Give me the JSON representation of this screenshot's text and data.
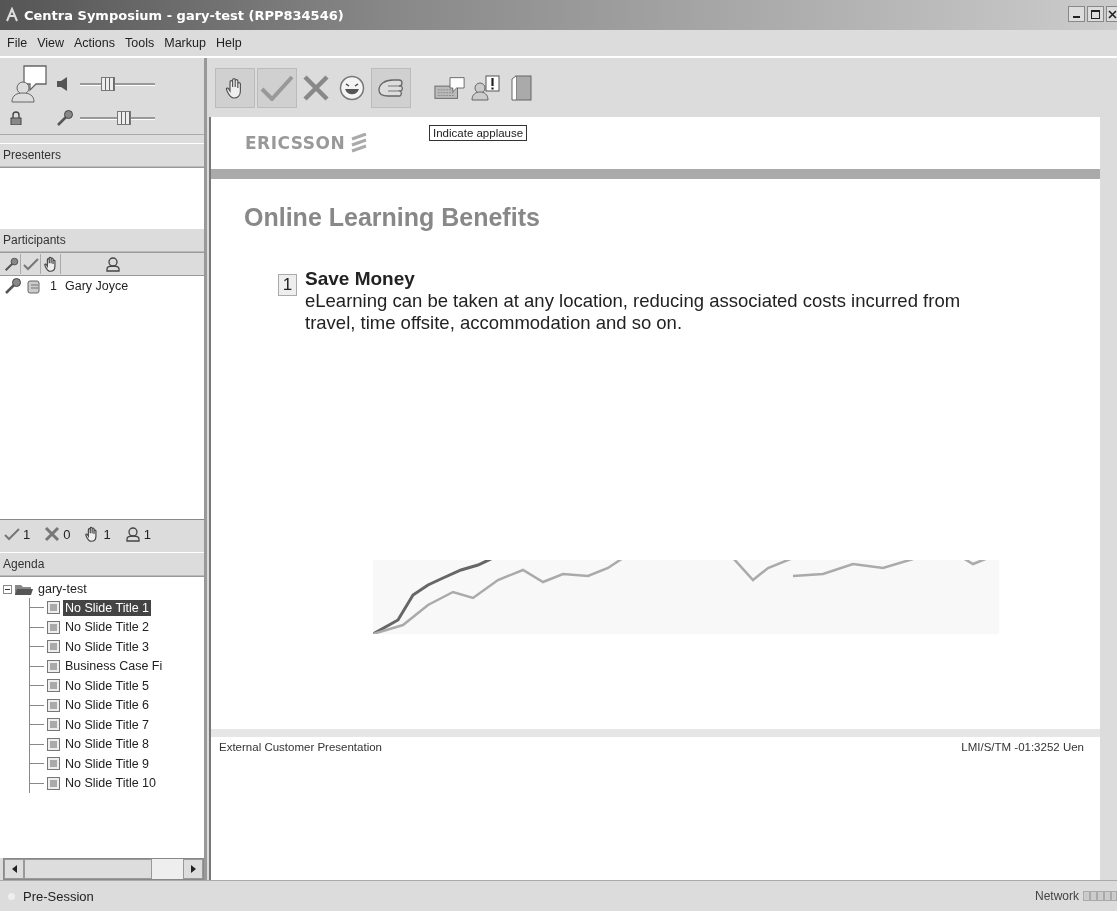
{
  "window": {
    "title": "Centra Symposium - gary-test (RPP834546)"
  },
  "menu": [
    "File",
    "View",
    "Actions",
    "Tools",
    "Markup",
    "Help"
  ],
  "audio": {
    "speaker": {
      "level": 0.35
    },
    "microphone": {
      "level": 0.6
    }
  },
  "tooltip": "Indicate applause",
  "presenters": {
    "title": "Presenters"
  },
  "participants": {
    "title": "Participants",
    "rows": [
      {
        "number": "1",
        "name": "Gary Joyce"
      }
    ]
  },
  "counts": [
    {
      "kind": "check",
      "value": "1"
    },
    {
      "kind": "cross",
      "value": "0"
    },
    {
      "kind": "hand",
      "value": "1"
    },
    {
      "kind": "person",
      "value": "1"
    }
  ],
  "agenda": {
    "title": "Agenda",
    "root": {
      "label": "gary-test",
      "expanded": true,
      "children": [
        {
          "label": "No Slide Title 1",
          "selected": true
        },
        {
          "label": "No Slide Title 2",
          "selected": false
        },
        {
          "label": "No Slide Title 3",
          "selected": false
        },
        {
          "label": "Business Case Fi",
          "selected": false
        },
        {
          "label": "No Slide Title 5",
          "selected": false
        },
        {
          "label": "No Slide Title 6",
          "selected": false
        },
        {
          "label": "No Slide Title 7",
          "selected": false
        },
        {
          "label": "No Slide Title 8",
          "selected": false
        },
        {
          "label": "No Slide Title 9",
          "selected": false
        },
        {
          "label": "No Slide Title 10",
          "selected": false
        }
      ]
    }
  },
  "slide": {
    "logo": "ERICSSON",
    "title": "Online Learning Benefits",
    "points": [
      {
        "number": "1",
        "heading": "Save Money",
        "body": "eLearning can be taken at any location, reducing associated costs incurred from travel, time offsite, accommodation and so on."
      }
    ],
    "footer_left": "External Customer Presentation",
    "footer_right": "LMI/S/TM -01:3252 Uen"
  },
  "status_bar": {
    "left": "Pre-Session",
    "right": "Network"
  }
}
